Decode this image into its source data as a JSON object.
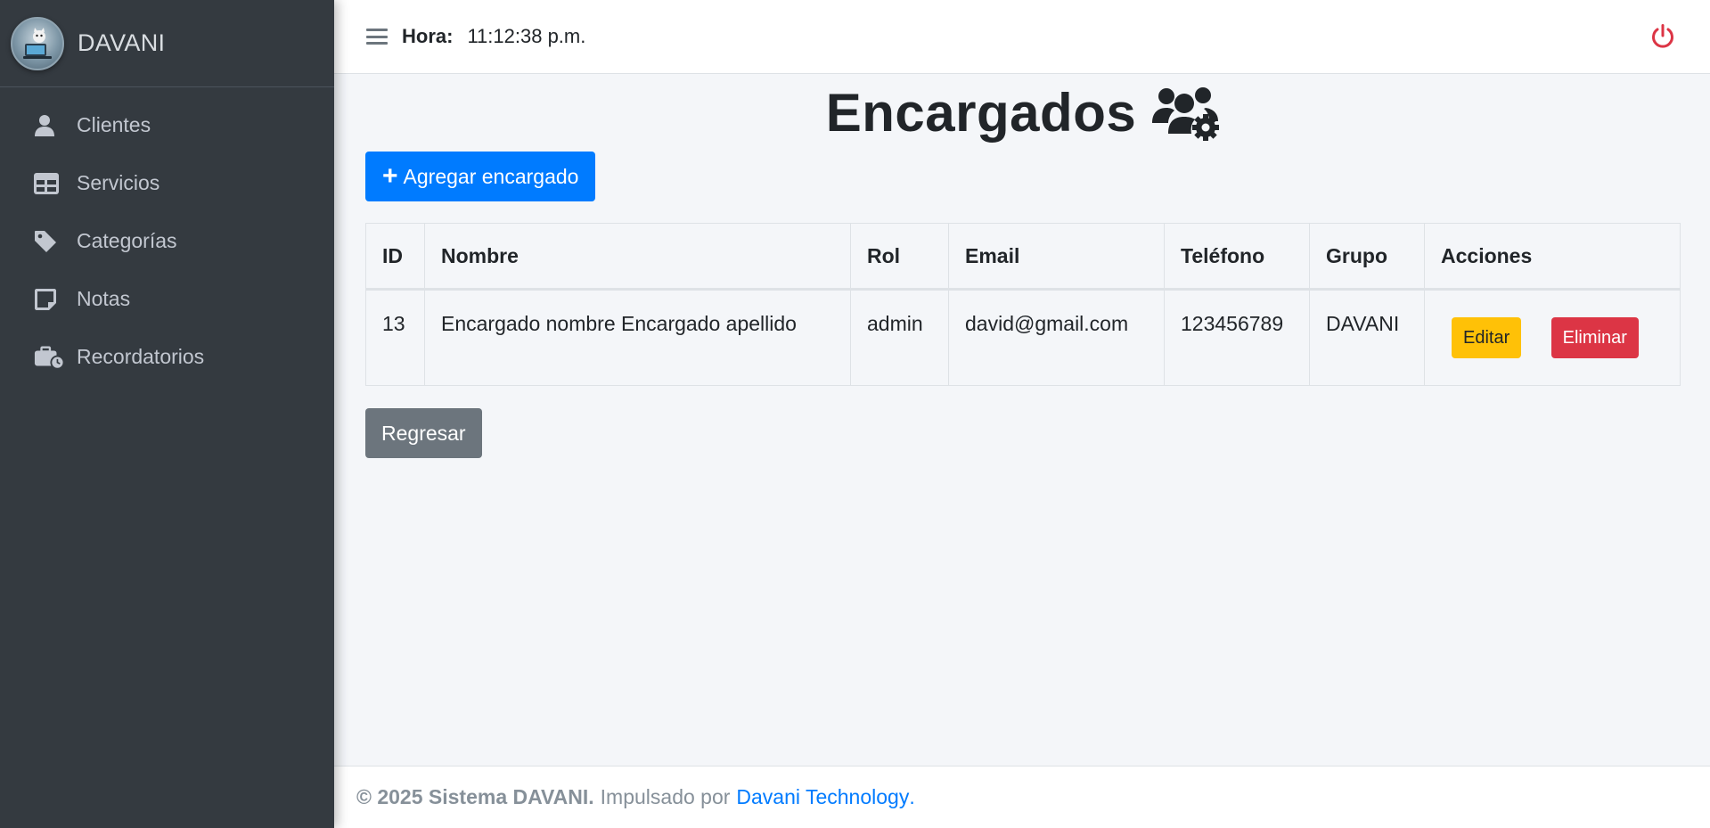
{
  "brand": {
    "name": "DAVANI"
  },
  "sidebar": {
    "items": [
      {
        "label": "Clientes",
        "icon": "user-icon"
      },
      {
        "label": "Servicios",
        "icon": "table-icon"
      },
      {
        "label": "Categorías",
        "icon": "tag-icon"
      },
      {
        "label": "Notas",
        "icon": "note-icon"
      },
      {
        "label": "Recordatorios",
        "icon": "briefcase-clock-icon"
      }
    ]
  },
  "header": {
    "hora_label": "Hora:",
    "hora_value": "11:12:38 p.m."
  },
  "main": {
    "title": "Encargados",
    "add_button": "Agregar encargado",
    "back_button": "Regresar",
    "table": {
      "headers": [
        "ID",
        "Nombre",
        "Rol",
        "Email",
        "Teléfono",
        "Grupo",
        "Acciones"
      ],
      "rows": [
        {
          "id": "13",
          "nombre": "Encargado nombre Encargado apellido",
          "rol": "admin",
          "email": "david@gmail.com",
          "telefono": "123456789",
          "grupo": "DAVANI",
          "edit_label": "Editar",
          "delete_label": "Eliminar"
        }
      ]
    }
  },
  "footer": {
    "copyright": "© 2025 Sistema DAVANI.",
    "powered_text": "Impulsado por",
    "link_text": "Davani Technology",
    "trailing": "."
  },
  "colors": {
    "sidebar_bg": "#343a40",
    "primary": "#007bff",
    "warning": "#ffc107",
    "danger": "#dc3545",
    "secondary": "#6c757d",
    "content_bg": "#f4f6f9"
  }
}
